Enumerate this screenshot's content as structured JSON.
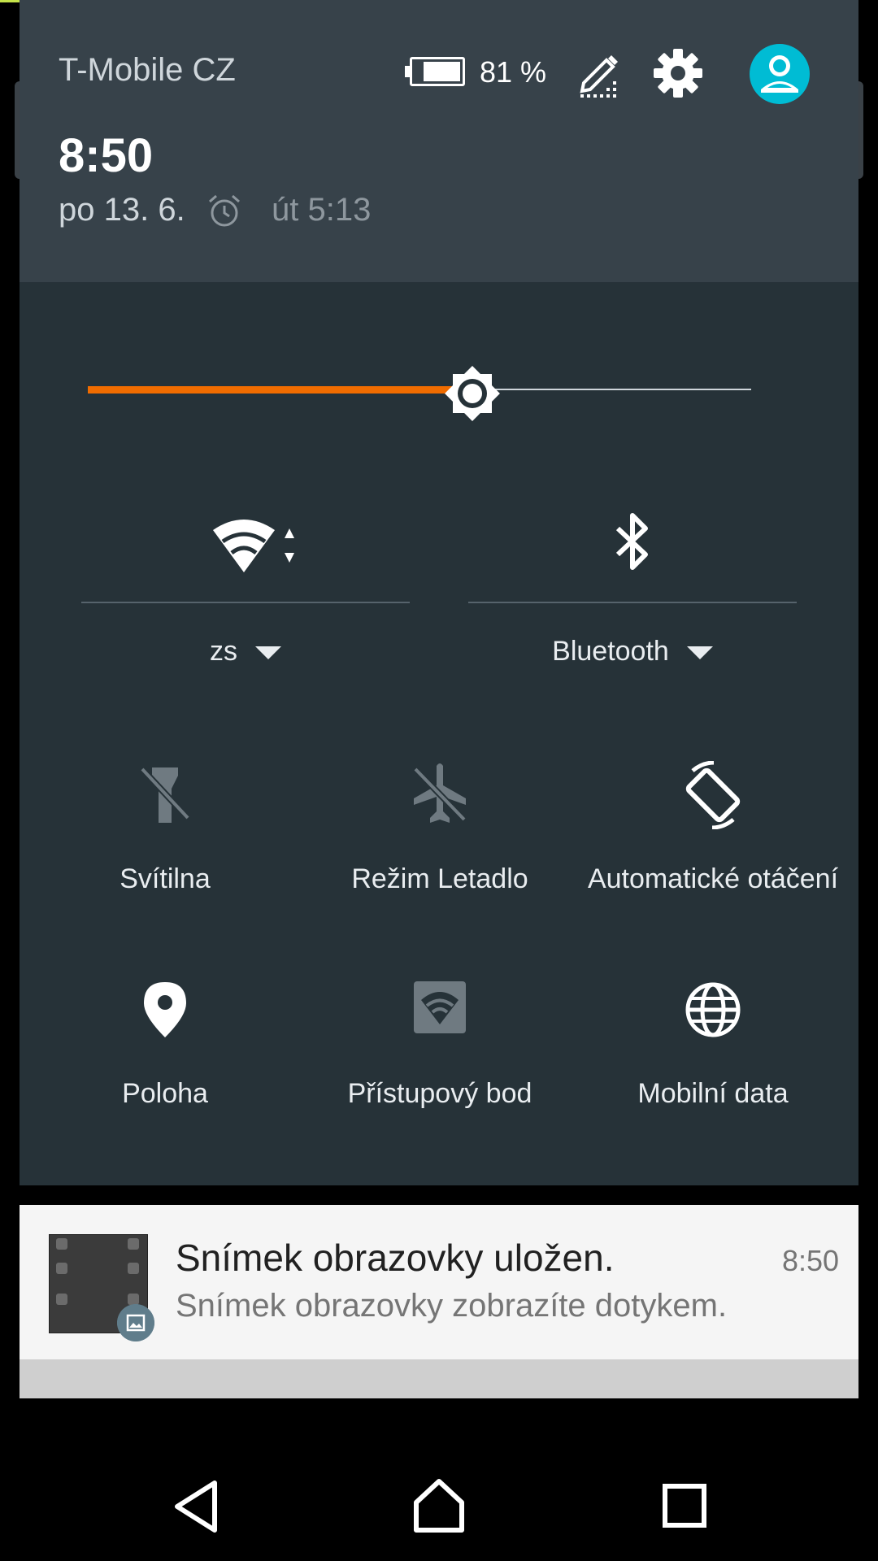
{
  "status_header": {
    "carrier": "T-Mobile CZ",
    "battery_percent": "81 %",
    "battery_level": 0.81,
    "time": "8:50",
    "date": "po 13. 6.",
    "next_alarm": "út 5:13",
    "icons": [
      "battery-icon",
      "edit-icon",
      "settings-icon",
      "user-avatar-icon",
      "alarm-icon"
    ]
  },
  "brightness": {
    "level": 0.58,
    "accent": "#f06c00"
  },
  "quick_settings": {
    "wifi": {
      "label": "zs",
      "icon": "wifi-icon"
    },
    "bluetooth": {
      "label": "Bluetooth",
      "icon": "bluetooth-icon"
    },
    "tiles": [
      {
        "label": "Svítilna",
        "icon": "flashlight-off-icon",
        "active": false
      },
      {
        "label": "Režim Letadlo",
        "icon": "airplane-mode-off-icon",
        "active": false
      },
      {
        "label": "Automatické otáčení",
        "icon": "auto-rotate-icon",
        "active": true
      },
      {
        "label": "Poloha",
        "icon": "location-icon",
        "active": true
      },
      {
        "label": "Přístupový bod",
        "icon": "hotspot-icon",
        "active": false
      },
      {
        "label": "Mobilní data",
        "icon": "mobile-data-icon",
        "active": true
      }
    ]
  },
  "notification": {
    "title": "Snímek obrazovky uložen.",
    "time": "8:50",
    "text": "Snímek obrazovky zobrazíte dotykem.",
    "icon": "image-icon"
  },
  "navbar": {
    "icons": [
      "back-icon",
      "home-icon",
      "recents-icon"
    ]
  },
  "colors": {
    "panel": "#263238",
    "header": "#37424a",
    "avatar": "#00bcd4",
    "accent": "#f06c00"
  }
}
